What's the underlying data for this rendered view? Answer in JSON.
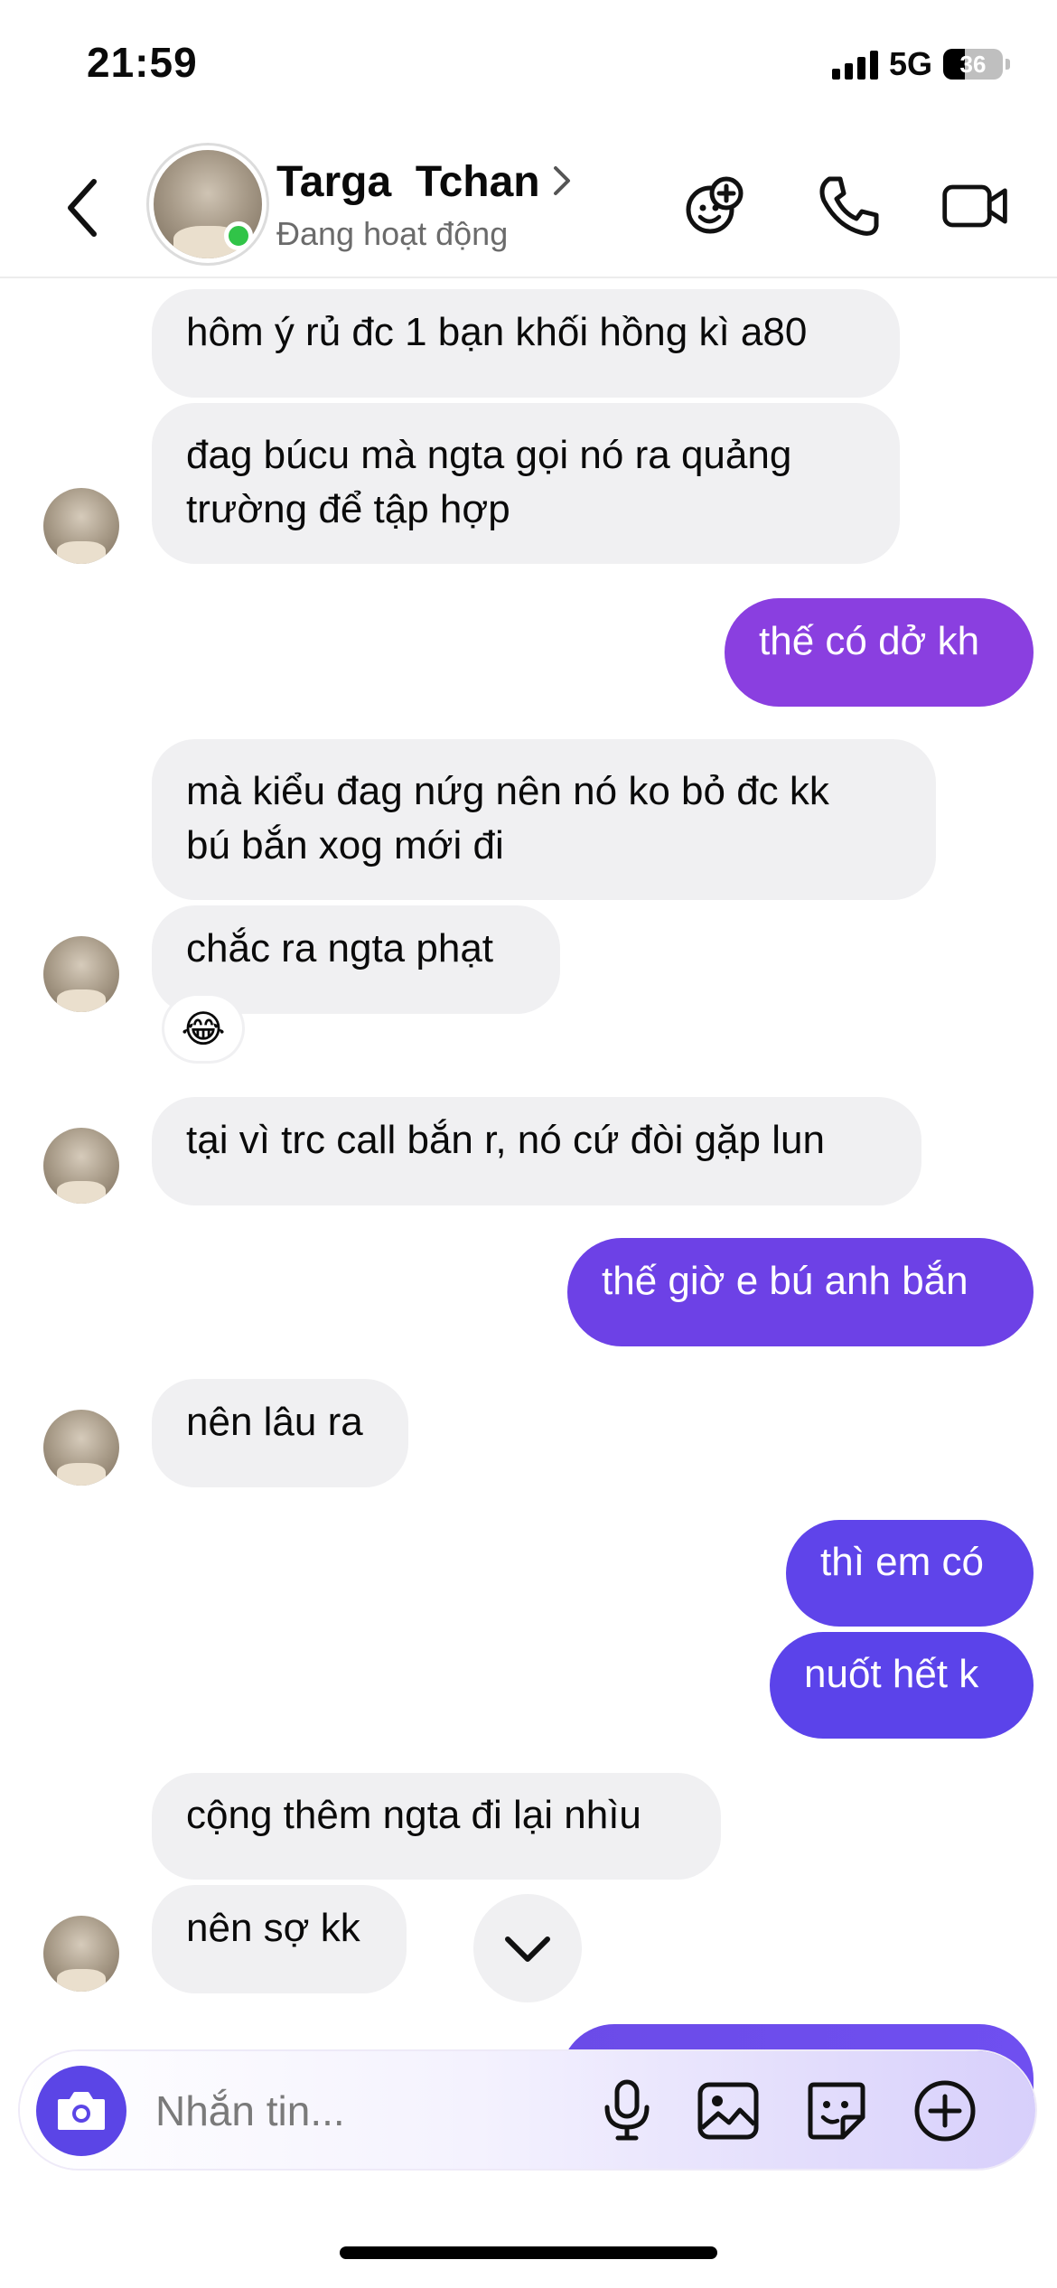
{
  "status_bar": {
    "time": "21:59",
    "network": "5G",
    "battery": "36"
  },
  "header": {
    "contact_name": "Targa  Tchan",
    "status": "Đang hoạt động",
    "online": true
  },
  "messages": [
    {
      "from": "them",
      "text": "hôm ý rủ đc 1 bạn khối hồng kì a80"
    },
    {
      "from": "them",
      "text_lines": [
        "đag búcu mà ngta gọi nó ra quảng",
        "trường để tập hợp"
      ]
    },
    {
      "from": "me",
      "text": "thế có dở kh"
    },
    {
      "from": "them",
      "text_lines": [
        "mà kiểu đag nứg nên nó ko bỏ đc kk",
        "bú bắn xog mới đi"
      ]
    },
    {
      "from": "them",
      "text": "chắc ra ngta phạt",
      "reaction": "😂"
    },
    {
      "from": "them",
      "text": "tại vì trc call bắn r, nó cứ đòi gặp lun"
    },
    {
      "from": "me",
      "text": "thế giờ e bú anh bắn"
    },
    {
      "from": "them",
      "text": "nên lâu ra"
    },
    {
      "from": "me",
      "text": "thì em có"
    },
    {
      "from": "me",
      "text": "nuốt hết k"
    },
    {
      "from": "them",
      "text": "cộng thêm ngta đi lại nhìu"
    },
    {
      "from": "them",
      "text": "nên sợ kk"
    }
  ],
  "composer": {
    "placeholder": "Nhắn tin..."
  },
  "colors": {
    "out_start": "#8a3fe0",
    "out_end": "#5b43ea",
    "in_bg": "#f0f0f2",
    "accent": "#5b45e6",
    "online": "#31c448"
  },
  "icons": [
    "back-chevron-icon",
    "add-emoji-icon",
    "phone-icon",
    "video-icon",
    "chevron-down-icon",
    "camera-icon",
    "microphone-icon",
    "image-icon",
    "sticker-icon",
    "plus-circle-icon"
  ]
}
